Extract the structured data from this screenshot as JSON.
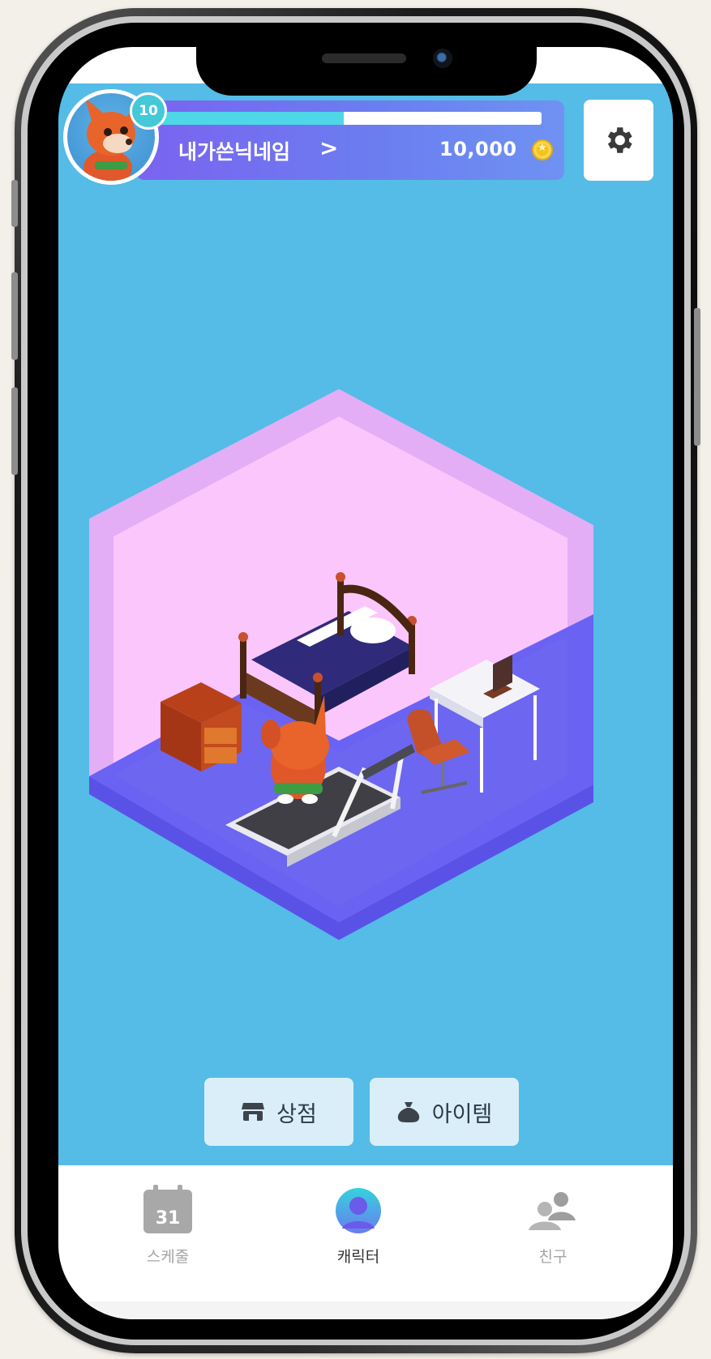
{
  "profile": {
    "level": "10",
    "nickname": "내가쓴닉네임",
    "chevron": ">",
    "coins": "10,000",
    "xp_fraction": 0.48
  },
  "actions": {
    "shop_label": "상점",
    "item_label": "아이템"
  },
  "tabbar": {
    "schedule_label": "스케줄",
    "schedule_day": "31",
    "character_label": "캐릭터",
    "friends_label": "친구",
    "active": "character"
  },
  "colors": {
    "app_background": "#54bce6",
    "profile_card_start": "#7b63f0",
    "profile_card_end": "#6f92f2",
    "xp_fill": "#4dd7e7",
    "room_wall": "#fbc6fb",
    "room_floor": "#6a62f2",
    "button_bg": "#d9eef8"
  },
  "icons": {
    "settings": "gear-icon",
    "coin": "coin-icon",
    "shop": "store-icon",
    "item": "pouch-icon",
    "schedule": "calendar-icon",
    "character": "person-icon",
    "friends": "users-icon"
  }
}
